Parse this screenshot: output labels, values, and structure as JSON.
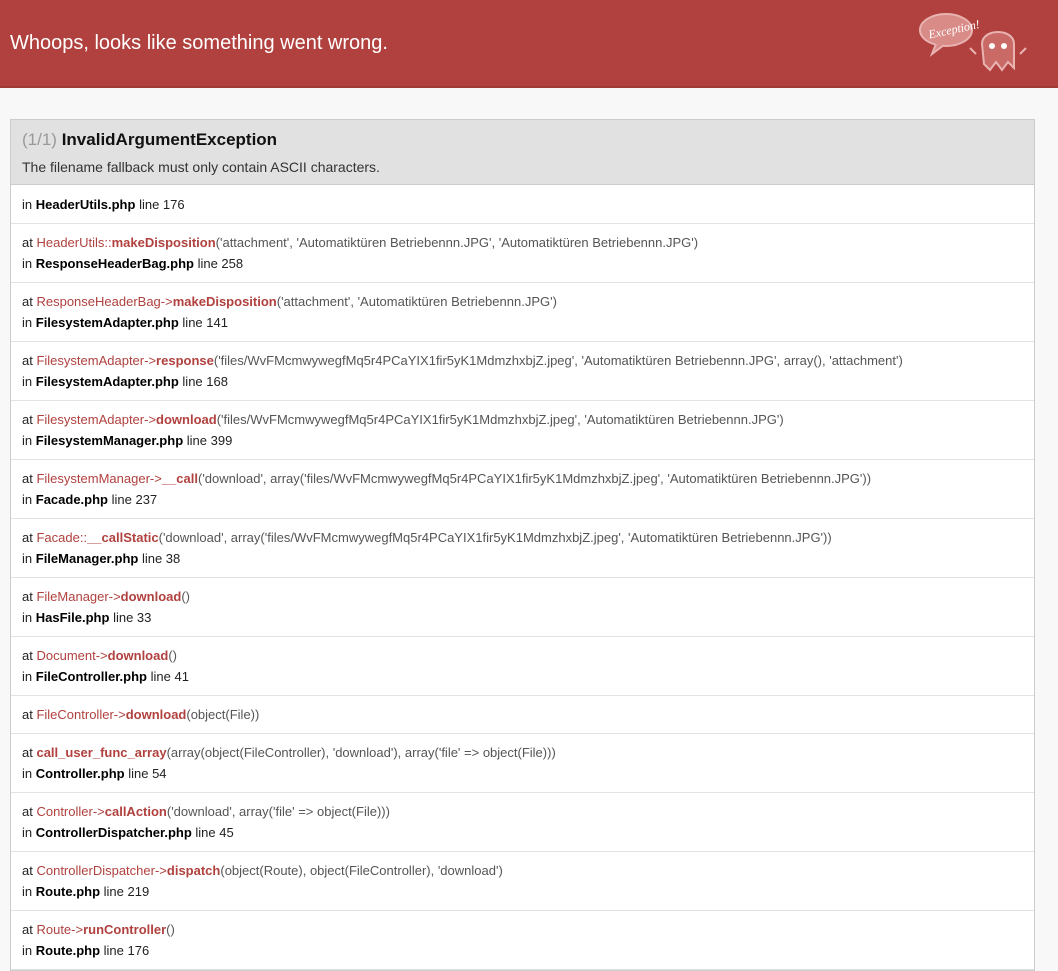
{
  "header": {
    "title": "Whoops, looks like something went wrong.",
    "badge_text": "Exception!"
  },
  "exception": {
    "count": "(1/1)",
    "type": "InvalidArgumentException",
    "message": "The filename fallback must only contain ASCII characters."
  },
  "first_frame": {
    "in_label": "in",
    "file": "HeaderUtils.php",
    "line": "line 176"
  },
  "frames": [
    {
      "at": "at",
      "cls": "HeaderUtils",
      "sep": "::",
      "fn": "makeDisposition",
      "args": "('attachment', 'Automatiktüren Betriebennn.JPG', 'Automatiktüren Betriebennn.JPG')",
      "in": "in",
      "file": "ResponseHeaderBag.php",
      "line": "line 258"
    },
    {
      "at": "at",
      "cls": "ResponseHeaderBag",
      "sep": "->",
      "fn": "makeDisposition",
      "args": "('attachment', 'Automatiktüren Betriebennn.JPG')",
      "in": "in",
      "file": "FilesystemAdapter.php",
      "line": "line 141"
    },
    {
      "at": "at",
      "cls": "FilesystemAdapter",
      "sep": "->",
      "fn": "response",
      "args": "('files/WvFMcmwywegfMq5r4PCaYIX1fir5yK1MdmzhxbjZ.jpeg', 'Automatiktüren Betriebennn.JPG', array(), 'attachment')",
      "in": "in",
      "file": "FilesystemAdapter.php",
      "line": "line 168"
    },
    {
      "at": "at",
      "cls": "FilesystemAdapter",
      "sep": "->",
      "fn": "download",
      "args": "('files/WvFMcmwywegfMq5r4PCaYIX1fir5yK1MdmzhxbjZ.jpeg', 'Automatiktüren Betriebennn.JPG')",
      "in": "in",
      "file": "FilesystemManager.php",
      "line": "line 399"
    },
    {
      "at": "at",
      "cls": "FilesystemManager",
      "sep": "->",
      "fn": "__call",
      "args": "('download', array('files/WvFMcmwywegfMq5r4PCaYIX1fir5yK1MdmzhxbjZ.jpeg', 'Automatiktüren Betriebennn.JPG'))",
      "in": "in",
      "file": "Facade.php",
      "line": "line 237"
    },
    {
      "at": "at",
      "cls": "Facade",
      "sep": "::",
      "fn": "__callStatic",
      "args": "('download', array('files/WvFMcmwywegfMq5r4PCaYIX1fir5yK1MdmzhxbjZ.jpeg', 'Automatiktüren Betriebennn.JPG'))",
      "in": "in",
      "file": "FileManager.php",
      "line": "line 38"
    },
    {
      "at": "at",
      "cls": "FileManager",
      "sep": "->",
      "fn": "download",
      "args": "()",
      "in": "in",
      "file": "HasFile.php",
      "line": "line 33"
    },
    {
      "at": "at",
      "cls": "Document",
      "sep": "->",
      "fn": "download",
      "args": "()",
      "in": "in",
      "file": "FileController.php",
      "line": "line 41"
    },
    {
      "at": "at",
      "cls": "FileController",
      "sep": "->",
      "fn": "download",
      "args": "(object(File))",
      "in": "",
      "file": "",
      "line": ""
    },
    {
      "at": "at",
      "cls": "",
      "sep": "",
      "fn": "call_user_func_array",
      "args": "(array(object(FileController), 'download'), array('file' => object(File)))",
      "in": "in",
      "file": "Controller.php",
      "line": "line 54"
    },
    {
      "at": "at",
      "cls": "Controller",
      "sep": "->",
      "fn": "callAction",
      "args": "('download', array('file' => object(File)))",
      "in": "in",
      "file": "ControllerDispatcher.php",
      "line": "line 45"
    },
    {
      "at": "at",
      "cls": "ControllerDispatcher",
      "sep": "->",
      "fn": "dispatch",
      "args": "(object(Route), object(FileController), 'download')",
      "in": "in",
      "file": "Route.php",
      "line": "line 219"
    },
    {
      "at": "at",
      "cls": "Route",
      "sep": "->",
      "fn": "runController",
      "args": "()",
      "in": "in",
      "file": "Route.php",
      "line": "line 176"
    }
  ]
}
